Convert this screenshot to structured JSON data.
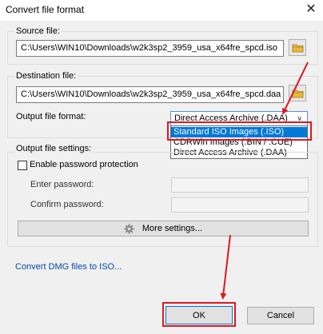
{
  "window": {
    "title": "Convert file format",
    "close_symbol": "✕"
  },
  "source": {
    "group_label": "Source file:",
    "path": "C:\\Users\\WIN10\\Downloads\\w2k3sp2_3959_usa_x64fre_spcd.iso"
  },
  "destination": {
    "group_label": "Destination file:",
    "path": "C:\\Users\\WIN10\\Downloads\\w2k3sp2_3959_usa_x64fre_spcd.daa",
    "format_label": "Output file format:",
    "format_selected": "Direct Access Archive (.DAA)",
    "format_options": [
      "Standard ISO Images (.ISO)",
      "CDRWin Images (.BIN / .CUE)",
      "Direct Access Archive (.DAA)"
    ],
    "highlighted_option": "Standard ISO Images (.ISO)"
  },
  "settings": {
    "group_label": "Output file settings:",
    "password_checkbox_label": "Enable password protection",
    "password_checked": false,
    "enter_password_label": "Enter password:",
    "confirm_password_label": "Confirm password:",
    "more_settings_label": "More settings..."
  },
  "link": {
    "dmg_label": "Convert DMG files to ISO..."
  },
  "buttons": {
    "ok_label": "OK",
    "cancel_label": "Cancel"
  },
  "colors": {
    "annotation_red": "#e0161d",
    "selection_blue": "#0078d7",
    "link_blue": "#0645ad",
    "folder_yellow": "#e8b93a"
  },
  "icons": {
    "folder": "folder-icon",
    "gear": "gear-icon",
    "dropdown": "chevron-down-icon",
    "close": "close-icon"
  }
}
